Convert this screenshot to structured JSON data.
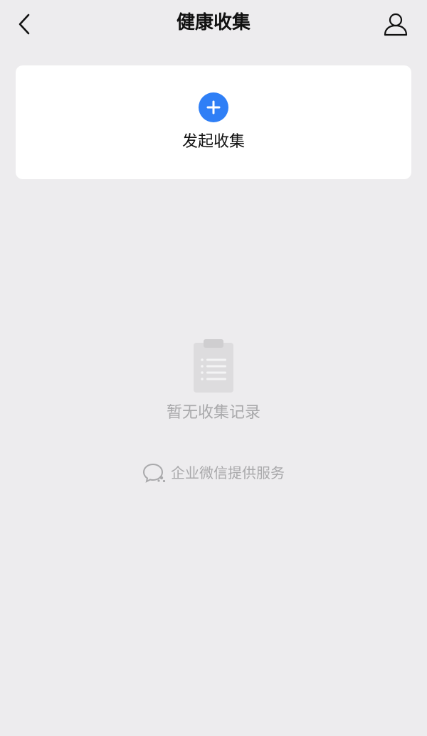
{
  "header": {
    "title": "健康收集",
    "back_icon": "chevron-left-icon",
    "profile_icon": "person-icon"
  },
  "start_card": {
    "label": "发起收集",
    "icon": "plus-circle-icon",
    "accent_color": "#2f7ff6"
  },
  "empty_state": {
    "icon": "clipboard-icon",
    "message": "暂无收集记录"
  },
  "footer": {
    "icon": "wecom-logo-icon",
    "text": "企业微信提供服务"
  },
  "colors": {
    "background": "#edecee",
    "card": "#ffffff",
    "muted_text": "#a9a9ab",
    "primary_text": "#111111"
  }
}
